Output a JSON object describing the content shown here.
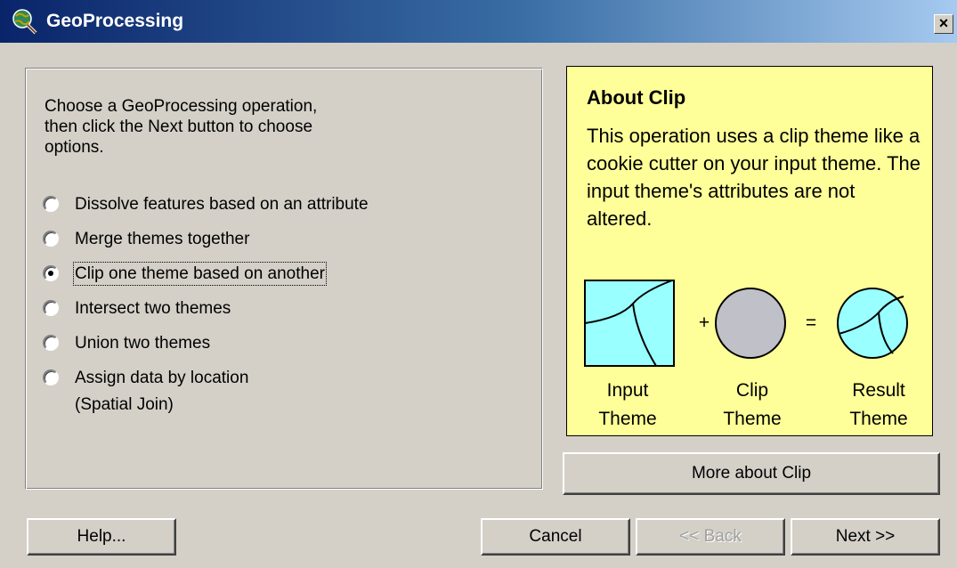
{
  "window": {
    "title": "GeoProcessing",
    "close_glyph": "×"
  },
  "instructions": "Choose a GeoProcessing operation,\nthen click the Next button to choose\noptions.",
  "operations": [
    {
      "label": "Dissolve features based on an attribute",
      "selected": false
    },
    {
      "label": "Merge themes together",
      "selected": false
    },
    {
      "label": "Clip one theme based on another",
      "selected": true
    },
    {
      "label": "Intersect two themes",
      "selected": false
    },
    {
      "label": "Union two themes",
      "selected": false
    },
    {
      "label": "Assign data by location",
      "sublabel": "(Spatial Join)",
      "selected": false
    }
  ],
  "about": {
    "title": "About Clip",
    "description": "This operation uses a clip theme like a cookie cutter on your input theme.  The input theme's attributes are not altered.",
    "diagram": {
      "plus": "+",
      "equals": "=",
      "input_caption_1": "Input",
      "input_caption_2": "Theme",
      "clip_caption_1": "Clip",
      "clip_caption_2": "Theme",
      "result_caption_1": "Result",
      "result_caption_2": "Theme"
    },
    "colors": {
      "panel": "#ffff99",
      "theme_fill": "#99ffff",
      "clip_fill": "#c0c0c8"
    }
  },
  "buttons": {
    "more_about": "More about Clip",
    "help": "Help...",
    "cancel": "Cancel",
    "back": "<< Back",
    "next": "Next >>"
  }
}
